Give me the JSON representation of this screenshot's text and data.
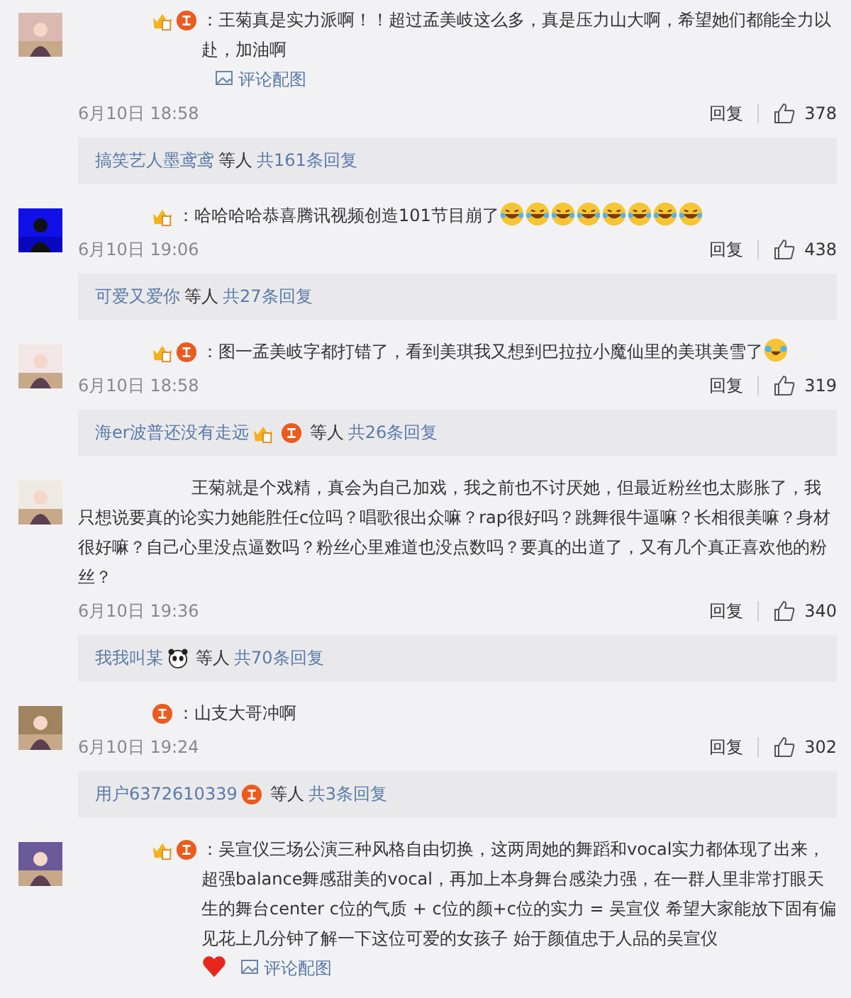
{
  "comments": [
    {
      "avatar": {
        "kind": "picture"
      },
      "badges": [
        {
          "kind": "crown"
        },
        {
          "kind": "red"
        }
      ],
      "text": "：王菊真是实力派啊！！超过孟美岐这么多，真是压力山大啊，希望她们都能全力以赴，加油啊",
      "image_link": "评论配图",
      "date": "6月10日 18:58",
      "reply": "回复",
      "likes": "378",
      "replies": {
        "user": "搞笑艺人墨鸢鸢",
        "others": "等人",
        "count": "共161条回复"
      }
    },
    {
      "avatar": {
        "kind": "picture"
      },
      "badges": [
        {
          "kind": "crown"
        }
      ],
      "text": "：哈哈哈哈恭喜腾讯视频创造101节目崩了",
      "icons": [
        {
          "kind": "laugh"
        },
        {
          "kind": "laugh"
        },
        {
          "kind": "laugh"
        },
        {
          "kind": "laugh"
        },
        {
          "kind": "laugh"
        },
        {
          "kind": "laugh"
        },
        {
          "kind": "laugh"
        },
        {
          "kind": "laugh"
        }
      ],
      "date": "6月10日 19:06",
      "reply": "回复",
      "likes": "438",
      "replies": {
        "user": "可爱又爱你",
        "others": "等人",
        "count": "共27条回复"
      }
    },
    {
      "avatar": {
        "kind": "picture"
      },
      "badges": [
        {
          "kind": "crown"
        },
        {
          "kind": "red"
        }
      ],
      "text": "：图一孟美岐字都打错了，看到美琪我又想到巴拉拉小魔仙里的美琪美雪了",
      "icons": [
        {
          "kind": "cry-laugh"
        }
      ],
      "date": "6月10日 18:58",
      "reply": "回复",
      "likes": "319",
      "replies": {
        "user": "海er波普还没有走远",
        "badges": [
          {
            "kind": "crown"
          },
          {
            "kind": "red"
          }
        ],
        "others": "等人",
        "count": "共26条回复"
      }
    },
    {
      "avatar": {
        "kind": "picture"
      },
      "text": "王菊就是个戏精，真会为自己加戏，我之前也不讨厌她，但最近粉丝也太膨胀了，我只想说要真的论实力她能胜任c位吗？唱歌很出众嘛？rap很好吗？跳舞很牛逼嘛？长相很美嘛？身材很好嘛？自己心里没点逼数吗？粉丝心里难道也没点数吗？要真的出道了，又有几个真正喜欢他的粉丝？",
      "date": "6月10日 19:36",
      "reply": "回复",
      "likes": "340",
      "replies": {
        "user": "我我叫某",
        "badges": [
          {
            "kind": "panda"
          }
        ],
        "others": "等人",
        "count": "共70条回复"
      }
    },
    {
      "avatar": {
        "kind": "picture"
      },
      "badges": [
        {
          "kind": "red"
        }
      ],
      "text": "：山支大哥冲啊",
      "date": "6月10日 19:24",
      "reply": "回复",
      "likes": "302",
      "replies": {
        "user": "用户6372610339",
        "badges": [
          {
            "kind": "red"
          }
        ],
        "others": "等人",
        "count": "共3条回复"
      }
    },
    {
      "avatar": {
        "kind": "picture"
      },
      "badges": [
        {
          "kind": "crown"
        },
        {
          "kind": "red"
        }
      ],
      "text": "：吴宣仪三场公演三种风格自由切换，这两周她的舞蹈和vocal实力都体现了出来，超强balance舞感甜美的vocal，再加上本身舞台感染力强，在一群人里非常打眼天生的舞台center c位的气质 + c位的颜+c位的实力 = 吴宣仪 希望大家能放下固有偏见花上几分钟了解一下这位可爱的女孩子 始于颜值忠于人品的吴宣仪",
      "icons": [
        {
          "kind": "heart"
        }
      ],
      "image_link": "评论配图"
    }
  ]
}
